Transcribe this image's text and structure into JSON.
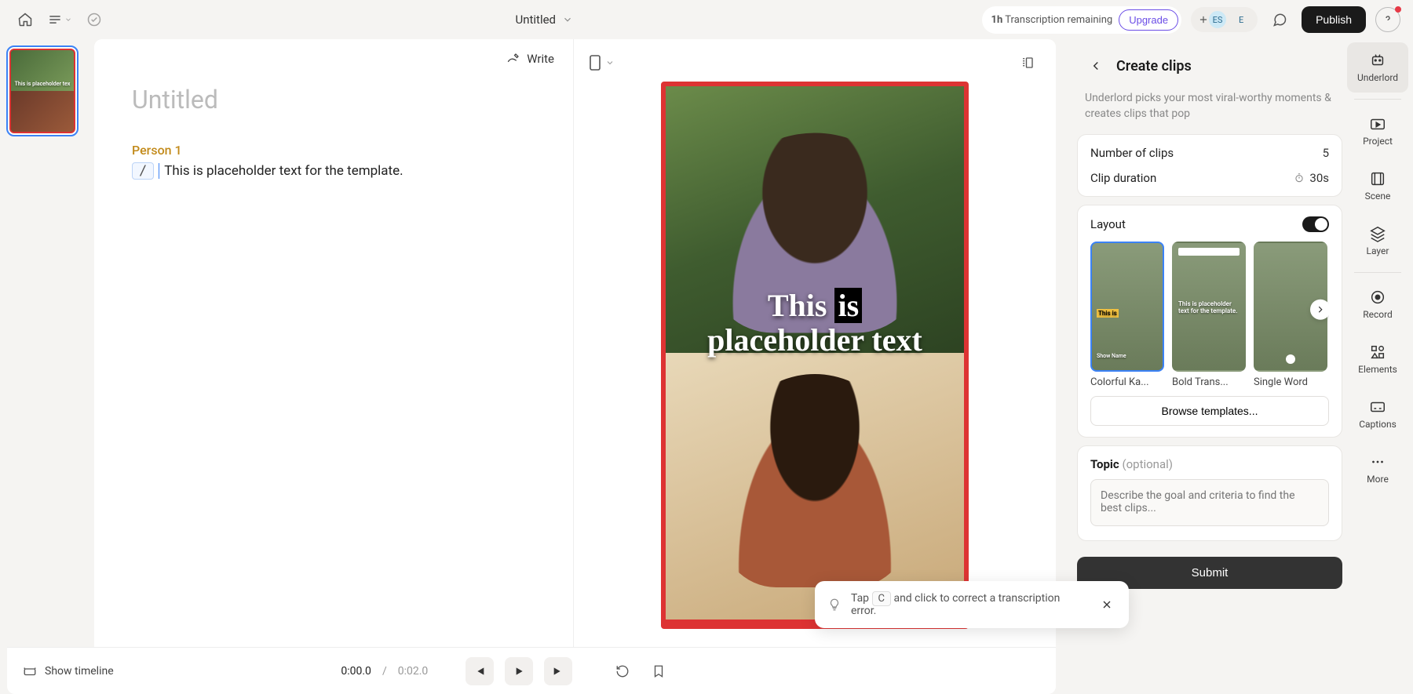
{
  "topbar": {
    "title": "Untitled",
    "usage_prefix": "1h",
    "usage_text": "Transcription remaining",
    "upgrade": "Upgrade",
    "avatar1": "ES",
    "avatar2": "E",
    "publish": "Publish"
  },
  "scenes": {
    "first_index": "1",
    "thumb_text": "This is placeholder tex"
  },
  "editor": {
    "write": "Write",
    "doc_title": "Untitled",
    "speaker": "Person 1",
    "slash": "/",
    "line": "This is placeholder text for the template."
  },
  "preview": {
    "overlay_line1_pre": "This ",
    "overlay_line1_hl": "is",
    "overlay_line2": "placeholder text"
  },
  "toast": {
    "pre": "Tap ",
    "key": "C",
    "post": " and click to correct a transcription error."
  },
  "timeline": {
    "show": "Show timeline",
    "current": "0:00.0",
    "sep": "/",
    "duration": "0:02.0"
  },
  "panel": {
    "title": "Create clips",
    "subtitle": "Underlord picks your most viral-worthy moments & creates clips that pop",
    "num_clips_label": "Number of clips",
    "num_clips_value": "5",
    "duration_label": "Clip duration",
    "duration_value": "30s",
    "layout_label": "Layout",
    "layouts": [
      {
        "label": "Colorful Ka...",
        "t1": "This is",
        "t2": "Show Name"
      },
      {
        "label": "Bold Trans...",
        "t1": "This is placeholder text for the template."
      },
      {
        "label": "Single Word",
        "t1": ""
      }
    ],
    "browse": "Browse templates...",
    "topic_label": "Topic",
    "topic_optional": "(optional)",
    "topic_placeholder": "Describe the goal and criteria to find the best clips...",
    "submit": "Submit"
  },
  "sidebar": {
    "items": [
      "Underlord",
      "Project",
      "Scene",
      "Layer",
      "Record",
      "Elements",
      "Captions",
      "More"
    ]
  }
}
